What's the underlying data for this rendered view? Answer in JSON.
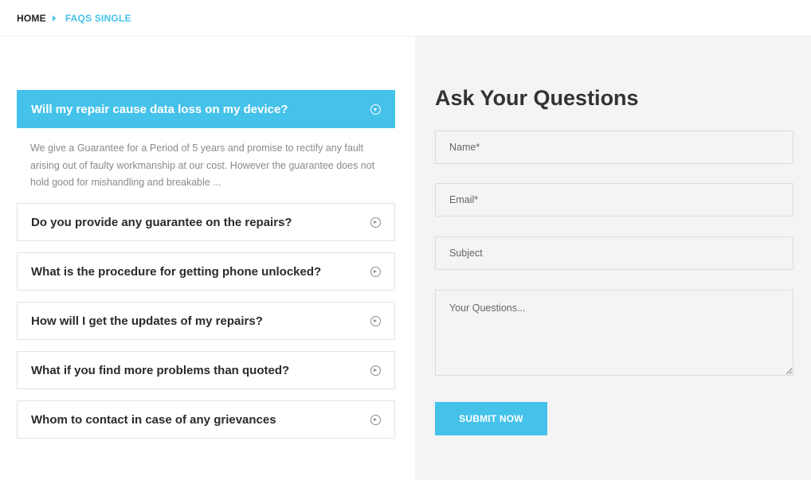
{
  "breadcrumb": {
    "home": "HOME",
    "current": "FAQS SINGLE"
  },
  "faq": {
    "open_item": {
      "question": "Will my repair cause data loss on my device?",
      "answer": "We give a Guarantee for a Period of 5 years and promise to rectify any fault arising out of faulty workmanship at our cost. However the guarantee does not hold good for mishandling and breakable ..."
    },
    "items": [
      "Do you provide any guarantee on the repairs?",
      "What is the procedure for getting phone unlocked?",
      "How will I get the updates of my repairs?",
      "What if you find more problems than quoted?",
      "Whom to contact in case of any grievances"
    ]
  },
  "form": {
    "title": "Ask Your Questions",
    "name_placeholder": "Name*",
    "email_placeholder": "Email*",
    "subject_placeholder": "Subject",
    "questions_placeholder": "Your Questions...",
    "submit_label": "SUBMIT NOW"
  },
  "colors": {
    "accent": "#45c2ea",
    "panel_bg": "#f4f4f4",
    "border": "#e3e3e3"
  },
  "icons": {
    "breadcrumb_separator": "caret-right-icon",
    "open": "circle-arrow-down-icon",
    "closed": "circle-arrow-right-icon"
  }
}
